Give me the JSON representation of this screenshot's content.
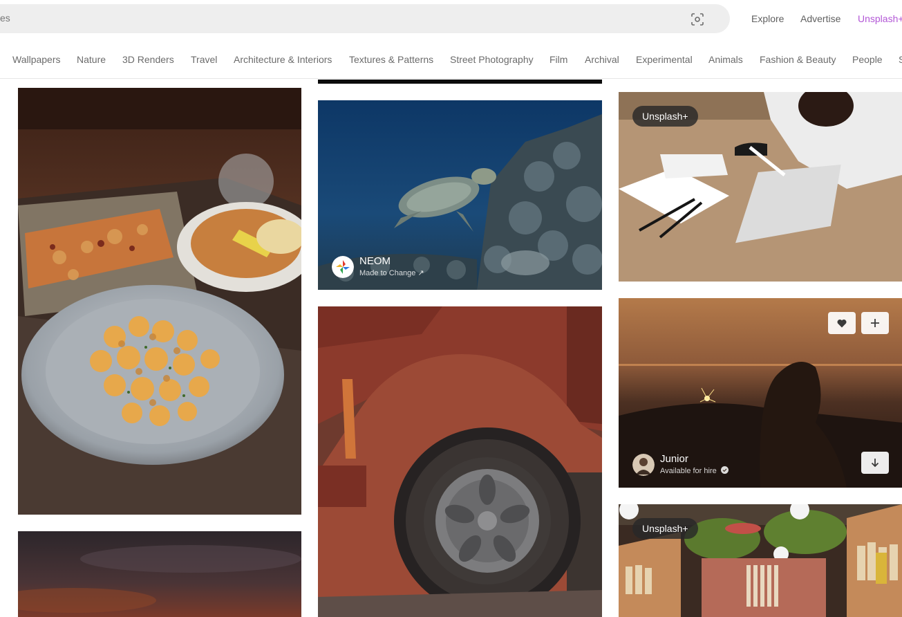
{
  "header": {
    "search_text": "es",
    "visual_search_icon": "visual-search-icon",
    "nav": {
      "explore": "Explore",
      "advertise": "Advertise",
      "unsplash_plus": "Unsplash+"
    },
    "colors": {
      "plus_accent": "#b256d6",
      "search_bg": "#eeeeee"
    }
  },
  "topics": [
    "Wallpapers",
    "Nature",
    "3D Renders",
    "Travel",
    "Architecture & Interiors",
    "Textures & Patterns",
    "Street Photography",
    "Film",
    "Archival",
    "Experimental",
    "Animals",
    "Fashion & Beauty",
    "People",
    "S"
  ],
  "photos": {
    "turtle": {
      "author": "NEOM",
      "subtitle": "Made to Change ↗"
    },
    "desk": {
      "badge": "Unsplash+"
    },
    "sunset": {
      "author": "Junior",
      "subtitle": "Available for hire",
      "verified_icon": "verified-check-icon",
      "like_icon": "heart-icon",
      "collect_icon": "plus-icon",
      "download_icon": "download-arrow-icon"
    },
    "library": {
      "badge": "Unsplash+"
    }
  }
}
